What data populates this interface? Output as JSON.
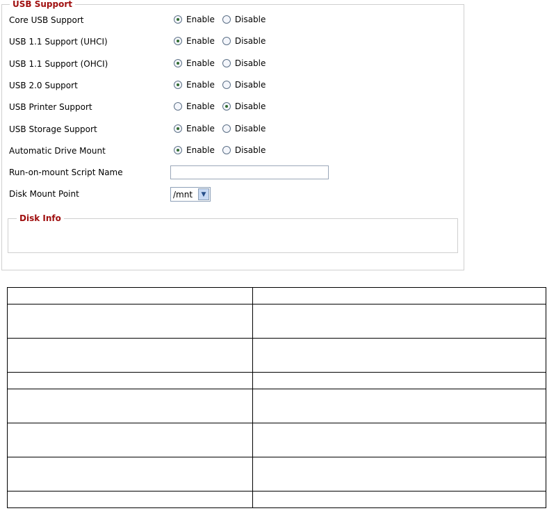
{
  "usb_support": {
    "legend": "USB Support",
    "rows": [
      {
        "label": "Core USB Support",
        "enable_label": "Enable",
        "disable_label": "Disable",
        "value": "enable"
      },
      {
        "label": "USB 1.1 Support (UHCI)",
        "enable_label": "Enable",
        "disable_label": "Disable",
        "value": "enable"
      },
      {
        "label": "USB 1.1 Support (OHCI)",
        "enable_label": "Enable",
        "disable_label": "Disable",
        "value": "enable"
      },
      {
        "label": "USB 2.0 Support",
        "enable_label": "Enable",
        "disable_label": "Disable",
        "value": "enable"
      },
      {
        "label": "USB Printer Support",
        "enable_label": "Enable",
        "disable_label": "Disable",
        "value": "disable"
      },
      {
        "label": "USB Storage Support",
        "enable_label": "Enable",
        "disable_label": "Disable",
        "value": "enable"
      },
      {
        "label": "Automatic Drive Mount",
        "enable_label": "Enable",
        "disable_label": "Disable",
        "value": "enable"
      }
    ],
    "script_name": {
      "label": "Run-on-mount Script Name",
      "value": ""
    },
    "mount_point": {
      "label": "Disk Mount Point",
      "value": "/mnt"
    },
    "disk_info": {
      "legend": "Disk Info"
    }
  },
  "info_table": {
    "rows": [
      {
        "kind": "thin",
        "cells": [
          "",
          ""
        ]
      },
      {
        "kind": "tall",
        "cells": [
          "",
          ""
        ]
      },
      {
        "kind": "tall",
        "cells": [
          "",
          ""
        ]
      },
      {
        "kind": "thin",
        "cells": [
          "",
          ""
        ]
      },
      {
        "kind": "tall",
        "cells": [
          "",
          ""
        ]
      },
      {
        "kind": "tall",
        "cells": [
          "",
          ""
        ]
      },
      {
        "kind": "tall",
        "cells": [
          "",
          ""
        ]
      },
      {
        "kind": "thin",
        "cells": [
          "",
          ""
        ]
      }
    ]
  }
}
